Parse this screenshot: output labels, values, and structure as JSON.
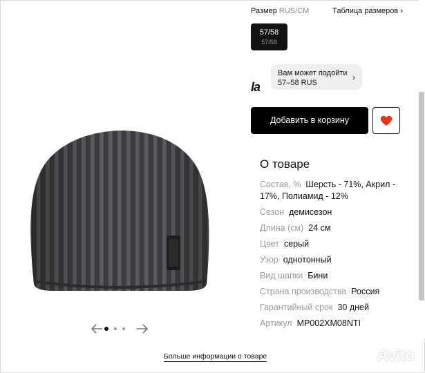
{
  "size": {
    "label": "Размер",
    "unit": "RUS/CM",
    "table_link": "Таблица размеров",
    "table_chevron": "›",
    "selected_main": "57/58",
    "selected_sub": "57/58"
  },
  "fit": {
    "brand_logo": "la",
    "line1": "Вам может подойти",
    "line2": "57–58 RUS",
    "chevron": "›"
  },
  "actions": {
    "add_to_cart": "Добавить в корзину"
  },
  "about": {
    "title": "О товаре",
    "properties": [
      {
        "key": "Состав, %",
        "value": "Шерсть - 71%, Акрил - 17%, Полиамид - 12%"
      },
      {
        "key": "Сезон",
        "value": "демисезон"
      },
      {
        "key": "Длина (см)",
        "value": "24 см"
      },
      {
        "key": "Цвет",
        "value": "серый"
      },
      {
        "key": "Узор",
        "value": "однотонный"
      },
      {
        "key": "Вид шапки",
        "value": "Бини"
      },
      {
        "key": "Страна производства",
        "value": "Россия"
      },
      {
        "key": "Гарантийный срок",
        "value": "30 дней"
      },
      {
        "key": "Артикул",
        "value": "MP002XM08NTI"
      }
    ]
  },
  "gallery": {
    "slide_count": 3,
    "active_slide": 1
  },
  "footer": {
    "more_info": "Больше информации о товаре"
  },
  "watermark": {
    "text": "Avito"
  },
  "colors": {
    "accent_heart": "#e8321e",
    "button_dark": "#000000",
    "muted_text": "#999999"
  }
}
